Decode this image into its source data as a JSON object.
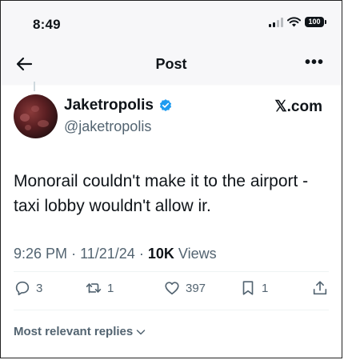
{
  "status_bar": {
    "time": "8:49",
    "battery": "100",
    "icons": [
      "signal-icon",
      "wifi-icon",
      "battery-icon"
    ]
  },
  "nav": {
    "back_icon": "arrow-left-icon",
    "title": "Post",
    "more_icon": "more-horizontal-icon"
  },
  "post": {
    "author": {
      "display_name": "Jaketropolis",
      "handle": "@jaketropolis",
      "verified": true,
      "badge_color": "#1d9bf0"
    },
    "source": "𝕏.com",
    "text": "Monorail couldn't make it to the airport - taxi lobby wouldn't allow ir.",
    "time": "9:26 PM",
    "separator": "·",
    "date": "11/21/24",
    "views_count": "10K",
    "views_label": "Views"
  },
  "actions": {
    "replies": "3",
    "reposts": "1",
    "likes": "397",
    "bookmarks": "1"
  },
  "replies_sort": {
    "label": "Most relevant replies"
  },
  "colors": {
    "text": "#0f1419",
    "secondary": "#536471",
    "accent": "#1d9bf0"
  }
}
